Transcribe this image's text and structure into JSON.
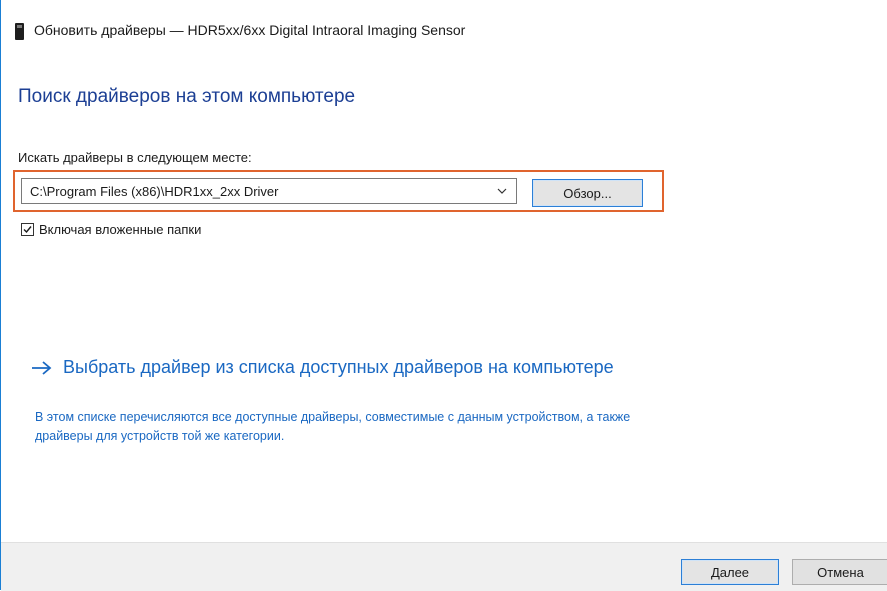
{
  "window": {
    "title": "Обновить драйверы — HDR5xx/6xx Digital Intraoral Imaging Sensor",
    "icon": "device-icon"
  },
  "main": {
    "heading": "Поиск драйверов на этом компьютере",
    "search_label": "Искать драйверы в следующем месте:",
    "path_value": "C:\\Program Files (x86)\\HDR1xx_2xx Driver",
    "browse_label": "Обзор...",
    "include_subfolders": {
      "label": "Включая вложенные папки",
      "checked": true
    },
    "choose_from_list": {
      "title": "Выбрать драйвер из списка доступных драйверов на компьютере",
      "description": "В этом списке перечисляются все доступные драйверы, совместимые с данным устройством, а также драйверы для устройств той же категории."
    }
  },
  "footer": {
    "next_label": "Далее",
    "cancel_label": "Отмена"
  },
  "colors": {
    "heading": "#1c3f94",
    "link": "#1a68c2",
    "highlight": "#e0642e",
    "button_focus_border": "#2c7fd6"
  }
}
